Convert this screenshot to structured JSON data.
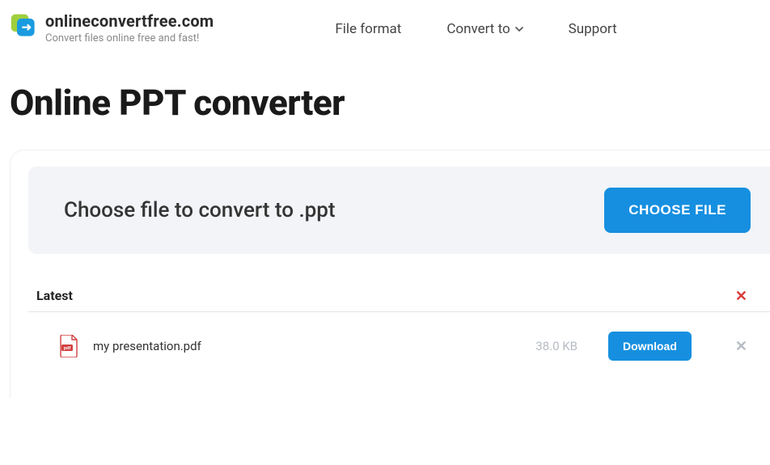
{
  "header": {
    "site_name": "onlineconvertfree.com",
    "tagline": "Convert files online free and fast!",
    "nav": {
      "file_format": "File format",
      "convert_to": "Convert to",
      "support": "Support"
    }
  },
  "page": {
    "title": "Online PPT converter"
  },
  "choose": {
    "label": "Choose file to convert to .ppt",
    "button": "CHOOSE FILE"
  },
  "latest": {
    "heading": "Latest",
    "files": [
      {
        "name": "my presentation.pdf",
        "size": "38.0 KB",
        "download_label": "Download"
      }
    ]
  }
}
